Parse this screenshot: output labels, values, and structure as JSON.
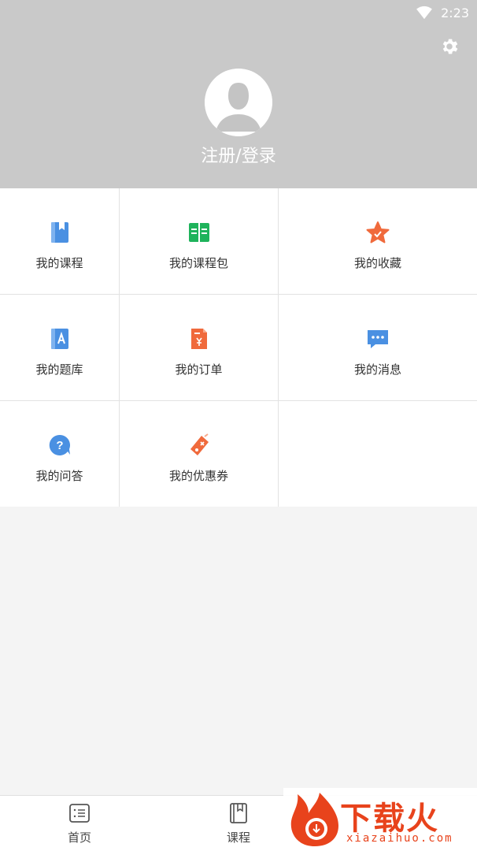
{
  "status_bar": {
    "time": "2:23"
  },
  "header": {
    "login_text": "注册/登录"
  },
  "grid": {
    "items": [
      {
        "label": "我的课程"
      },
      {
        "label": "我的课程包"
      },
      {
        "label": "我的收藏"
      },
      {
        "label": "我的题库"
      },
      {
        "label": "我的订单"
      },
      {
        "label": "我的消息"
      },
      {
        "label": "我的问答"
      },
      {
        "label": "我的优惠券"
      }
    ]
  },
  "bottom_nav": {
    "items": [
      {
        "label": "首页"
      },
      {
        "label": "课程"
      }
    ]
  },
  "watermark": {
    "title": "下载火",
    "subtitle": "xiazaihuo.com"
  },
  "colors": {
    "header_bg": "#c9c9c9",
    "icon_blue": "#4a90e2",
    "icon_green": "#1fb35b",
    "icon_orange": "#f06a3c",
    "brand_red": "#e8431c"
  }
}
